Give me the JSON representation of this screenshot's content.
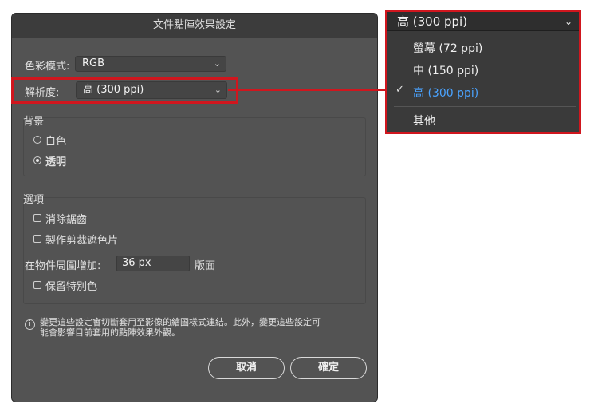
{
  "dialog": {
    "title": "文件點陣效果設定",
    "color_mode": {
      "label": "色彩模式:",
      "value": "RGB"
    },
    "resolution": {
      "label": "解析度:",
      "value": "高 (300 ppi)"
    },
    "background": {
      "group_label": "背景",
      "options": [
        {
          "label": "白色",
          "selected": false
        },
        {
          "label": "透明",
          "selected": true
        }
      ]
    },
    "options": {
      "group_label": "選項",
      "antialias_label": "消除鋸齒",
      "clipping_mask_label": "製作剪裁遮色片",
      "add_around_label": "在物件周圍增加:",
      "add_around_value": "36 px",
      "add_around_unit": "版面",
      "preserve_spot_label": "保留特別色"
    },
    "info_text_line1": "變更這些設定會切斷套用至影像的繪圖樣式連結。此外，變更這些設定可",
    "info_text_line2": "能會影響目前套用的點陣效果外觀。",
    "cancel_label": "取消",
    "ok_label": "確定"
  },
  "dropdown": {
    "current": "高 (300 ppi)",
    "items": [
      {
        "label": "螢幕 (72 ppi)",
        "selected": false
      },
      {
        "label": "中 (150 ppi)",
        "selected": false
      },
      {
        "label": "高 (300 ppi)",
        "selected": true
      },
      {
        "label": "其他",
        "selected": false
      }
    ]
  },
  "colors": {
    "dialog_bg": "#535353",
    "highlight": "#d0161e",
    "selected_item": "#4aa3ff"
  }
}
